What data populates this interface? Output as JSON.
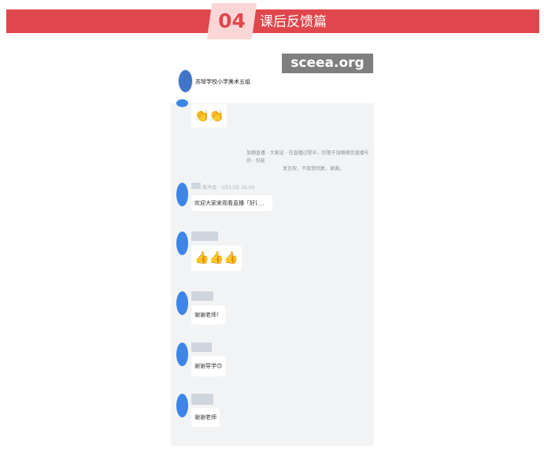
{
  "banner": {
    "number": "04",
    "title": "课后反馈篇",
    "color": "#e0474c",
    "badge_color": "#fbd6d7"
  },
  "chat": {
    "group_name": "苏琴学校小学美术五组",
    "watermark": "sceea.org",
    "system_message_line1": "加踏直播 · 大家这 · 在直播过程中，仅限于加踏微信直播号的 · 仅能",
    "system_message_line2": "发言权，不接受回复，谢谢。",
    "sender_meta": "美术组 · 2月13日 16:00",
    "messages": [
      {
        "type": "emoji",
        "icon": "clapping-hands-icon",
        "text": "👏👏"
      },
      {
        "type": "text",
        "text": "欢迎大家来观看直播「好评」。"
      },
      {
        "type": "emoji",
        "icon": "thumbs-up-icon",
        "text": "👍👍👍"
      },
      {
        "type": "text",
        "text": "谢谢老师！"
      },
      {
        "type": "text",
        "text": "谢谢导学😊"
      },
      {
        "type": "text",
        "text": "谢谢老师"
      }
    ],
    "more_label": "…"
  }
}
